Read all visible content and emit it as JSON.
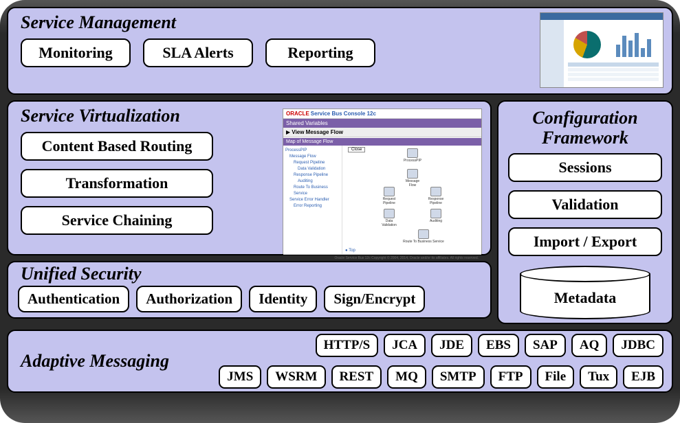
{
  "serviceManagement": {
    "title": "Service Management",
    "items": [
      "Monitoring",
      "SLA Alerts",
      "Reporting"
    ]
  },
  "serviceVirtualization": {
    "title": "Service Virtualization",
    "items": [
      "Content Based Routing",
      "Transformation",
      "Service Chaining"
    ],
    "console": {
      "brand_left": "ORACLE",
      "brand_right": "Service Bus Console 12c",
      "shared": "Shared Variables",
      "view": "View Message Flow",
      "map": "Map of Message Flow",
      "close": "Close",
      "tree": [
        "ProcessPIP",
        "Message Flow",
        "Request Pipeline",
        "Data Validation",
        "Response Pipeline",
        "Auditing",
        "Route To Business Service",
        "Service Error Handler",
        "Error Reporting"
      ],
      "nodes": {
        "process": "ProcessPIP",
        "msgflow": "Message Flow",
        "req": "Request Pipeline",
        "resp": "Response Pipeline",
        "dv": "Data Validation",
        "audit": "Auditing",
        "route": "Route To Business Service"
      },
      "top": "Top",
      "footer": "Oracle Service Bus 12c Copyright © 2004, 2014, Oracle and/or its affiliates. All rights reserved."
    }
  },
  "configurationFramework": {
    "title": "Configuration Framework",
    "items": [
      "Sessions",
      "Validation",
      "Import / Export"
    ],
    "metadata": "Metadata"
  },
  "unifiedSecurity": {
    "title": "Unified Security",
    "items": [
      "Authentication",
      "Authorization",
      "Identity",
      "Sign/Encrypt"
    ]
  },
  "adaptiveMessaging": {
    "title": "Adaptive Messaging",
    "row1": [
      "HTTP/S",
      "JCA",
      "JDE",
      "EBS",
      "SAP",
      "AQ",
      "JDBC"
    ],
    "row2": [
      "JMS",
      "WSRM",
      "REST",
      "MQ",
      "SMTP",
      "FTP",
      "File",
      "Tux",
      "EJB"
    ]
  }
}
